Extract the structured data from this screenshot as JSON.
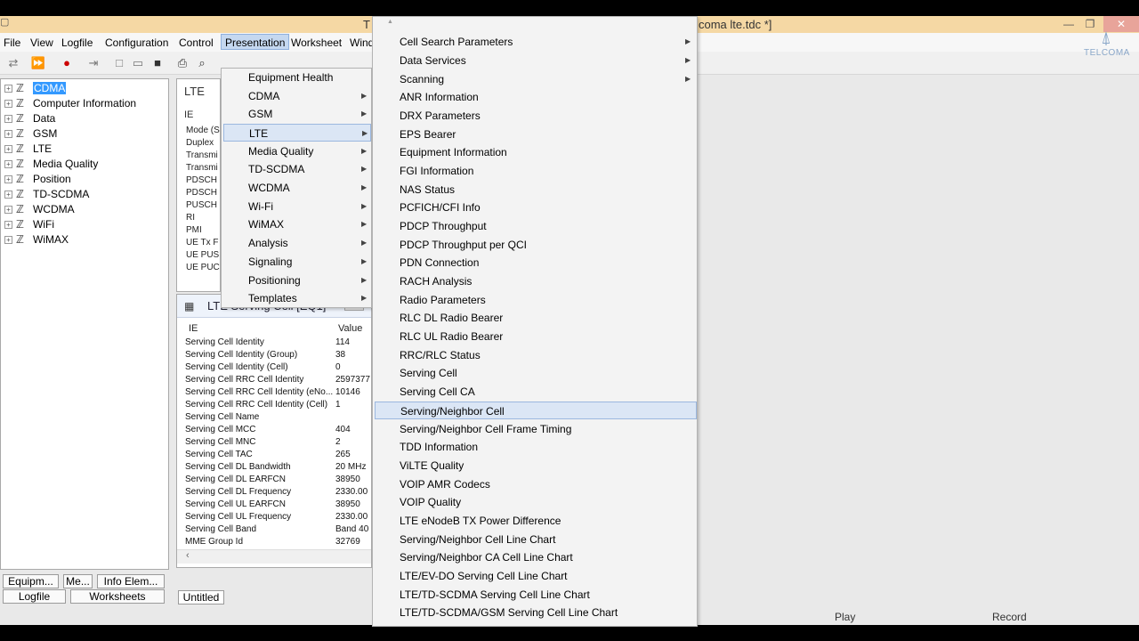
{
  "window": {
    "title_left": "T",
    "title_right": "coma lte.tdc *]"
  },
  "menubar": [
    "File",
    "View",
    "Logfile",
    "Configuration",
    "Control",
    "Presentation",
    "Worksheet",
    "Wind"
  ],
  "logo_text": "TELCOMA",
  "tree": [
    "CDMA",
    "Computer Information",
    "Data",
    "GSM",
    "LTE",
    "Media Quality",
    "Position",
    "TD-SCDMA",
    "WCDMA",
    "WiFi",
    "WiMAX"
  ],
  "bottom_tabs": {
    "row1": [
      "Equipm...",
      "Me...",
      "Info Elem..."
    ],
    "row2": [
      "Logfile",
      "Worksheets"
    ]
  },
  "mid_top": {
    "title": "LTE",
    "header": "IE",
    "rows": [
      "Mode (S",
      "Duplex",
      "Transmi",
      "Transmi",
      "PDSCH",
      "PDSCH",
      "PUSCH",
      "RI",
      "PMI",
      "UE Tx F",
      "UE PUS",
      "UE PUC"
    ]
  },
  "serving": {
    "title": "LTE Serving Cell [EQ1]",
    "col_ie": "IE",
    "col_value": "Value",
    "rows": [
      {
        "ie": "Serving Cell Identity",
        "value": "114"
      },
      {
        "ie": "Serving Cell Identity (Group)",
        "value": "38"
      },
      {
        "ie": "Serving Cell Identity (Cell)",
        "value": "0"
      },
      {
        "ie": "Serving Cell RRC Cell Identity",
        "value": "2597377"
      },
      {
        "ie": "Serving Cell RRC Cell Identity (eNo...",
        "value": "10146"
      },
      {
        "ie": "Serving Cell RRC Cell Identity (Cell)",
        "value": "1"
      },
      {
        "ie": "Serving Cell Name",
        "value": ""
      },
      {
        "ie": "Serving Cell MCC",
        "value": "404"
      },
      {
        "ie": "Serving Cell MNC",
        "value": "2"
      },
      {
        "ie": "Serving Cell TAC",
        "value": "265"
      },
      {
        "ie": "Serving Cell DL Bandwidth",
        "value": "20 MHz"
      },
      {
        "ie": "Serving Cell DL EARFCN",
        "value": "38950"
      },
      {
        "ie": "Serving Cell DL Frequency",
        "value": "2330.00"
      },
      {
        "ie": "Serving Cell UL EARFCN",
        "value": "38950"
      },
      {
        "ie": "Serving Cell UL Frequency",
        "value": "2330.00"
      },
      {
        "ie": "Serving Cell Band",
        "value": "Band 40"
      },
      {
        "ie": "MME Group Id",
        "value": "32769"
      }
    ]
  },
  "untitled_tab": "Untitled",
  "status": {
    "play": "Play",
    "record": "Record"
  },
  "presentation_menu": [
    {
      "label": "Equipment Health",
      "sub": false
    },
    {
      "label": "CDMA",
      "sub": true
    },
    {
      "label": "GSM",
      "sub": true
    },
    {
      "label": "LTE",
      "sub": true
    },
    {
      "label": "Media Quality",
      "sub": true
    },
    {
      "label": "TD-SCDMA",
      "sub": true
    },
    {
      "label": "WCDMA",
      "sub": true
    },
    {
      "label": "Wi-Fi",
      "sub": true
    },
    {
      "label": "WiMAX",
      "sub": true
    },
    {
      "label": "Analysis",
      "sub": true
    },
    {
      "label": "Signaling",
      "sub": true
    },
    {
      "label": "Positioning",
      "sub": true
    },
    {
      "label": "Templates",
      "sub": true
    }
  ],
  "lte_menu": [
    {
      "label": "Cell Search Parameters",
      "sub": true
    },
    {
      "label": "Data Services",
      "sub": true
    },
    {
      "label": "Scanning",
      "sub": true
    },
    {
      "label": "ANR Information",
      "sub": false
    },
    {
      "label": "DRX Parameters",
      "sub": false
    },
    {
      "label": "EPS Bearer",
      "sub": false
    },
    {
      "label": "Equipment Information",
      "sub": false
    },
    {
      "label": "FGI Information",
      "sub": false
    },
    {
      "label": "NAS Status",
      "sub": false
    },
    {
      "label": "PCFICH/CFI Info",
      "sub": false
    },
    {
      "label": "PDCP Throughput",
      "sub": false
    },
    {
      "label": "PDCP Throughput per QCI",
      "sub": false
    },
    {
      "label": "PDN Connection",
      "sub": false
    },
    {
      "label": "RACH Analysis",
      "sub": false
    },
    {
      "label": "Radio Parameters",
      "sub": false
    },
    {
      "label": "RLC DL Radio Bearer",
      "sub": false
    },
    {
      "label": "RLC UL Radio Bearer",
      "sub": false
    },
    {
      "label": "RRC/RLC Status",
      "sub": false
    },
    {
      "label": "Serving Cell",
      "sub": false
    },
    {
      "label": "Serving Cell CA",
      "sub": false
    },
    {
      "label": "Serving/Neighbor Cell",
      "sub": false
    },
    {
      "label": "Serving/Neighbor Cell Frame Timing",
      "sub": false
    },
    {
      "label": "TDD Information",
      "sub": false
    },
    {
      "label": "ViLTE Quality",
      "sub": false
    },
    {
      "label": "VOIP AMR Codecs",
      "sub": false
    },
    {
      "label": "VOIP Quality",
      "sub": false
    },
    {
      "label": "LTE eNodeB TX Power Difference",
      "sub": false
    },
    {
      "label": "Serving/Neighbor Cell Line Chart",
      "sub": false
    },
    {
      "label": "Serving/Neighbor CA Cell Line Chart",
      "sub": false
    },
    {
      "label": "LTE/EV-DO Serving Cell Line Chart",
      "sub": false
    },
    {
      "label": "LTE/TD-SCDMA Serving Cell Line Chart",
      "sub": false
    },
    {
      "label": "LTE/TD-SCDMA/GSM Serving Cell Line Chart",
      "sub": false
    }
  ]
}
